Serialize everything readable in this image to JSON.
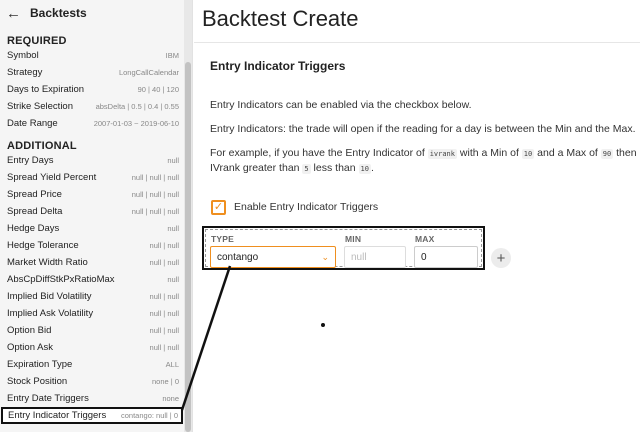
{
  "sidebar": {
    "back_icon": "arrow-left-icon",
    "title": "Backtests",
    "required_label": "REQUIRED",
    "required_items": [
      {
        "label": "Symbol",
        "value": "IBM"
      },
      {
        "label": "Strategy",
        "value": "LongCallCalendar"
      },
      {
        "label": "Days to Expiration",
        "value": "90 | 40 | 120"
      },
      {
        "label": "Strike Selection",
        "value": "absDelta | 0.5 | 0.4 | 0.55"
      },
      {
        "label": "Date Range",
        "value": "2007-01-03 ~ 2019-06-10"
      }
    ],
    "additional_label": "ADDITIONAL",
    "additional_items": [
      {
        "label": "Entry Days",
        "value": "null"
      },
      {
        "label": "Spread Yield Percent",
        "value": "null | null | null"
      },
      {
        "label": "Spread Price",
        "value": "null | null | null"
      },
      {
        "label": "Spread Delta",
        "value": "null | null | null"
      },
      {
        "label": "Hedge Days",
        "value": "null"
      },
      {
        "label": "Hedge Tolerance",
        "value": "null | null"
      },
      {
        "label": "Market Width Ratio",
        "value": "null | null"
      },
      {
        "label": "AbsCpDiffStkPxRatioMax",
        "value": "null"
      },
      {
        "label": "Implied Bid Volatility",
        "value": "null | null"
      },
      {
        "label": "Implied Ask Volatility",
        "value": "null | null"
      },
      {
        "label": "Option Bid",
        "value": "null | null"
      },
      {
        "label": "Option Ask",
        "value": "null | null"
      },
      {
        "label": "Expiration Type",
        "value": "ALL"
      },
      {
        "label": "Stock Position",
        "value": "none | 0"
      },
      {
        "label": "Entry Date Triggers",
        "value": "none"
      },
      {
        "label": "Entry Indicator Triggers",
        "value": "contango: null | 0"
      }
    ]
  },
  "main": {
    "title": "Backtest Create",
    "section_title": "Entry Indicator Triggers",
    "para1": "Entry Indicators can be enabled via the checkbox below.",
    "para2": "Entry Indicators: the trade will open if the reading for a day is between the Min and the Max.",
    "para3_a": "For example, if you have the Entry Indicator of ",
    "para3_code1": "ivrank",
    "para3_b": " with a Min of ",
    "para3_code2": "10",
    "para3_c": " and a Max of ",
    "para3_code3": "90",
    "para3_d": " then",
    "para4_a": "IVrank greater than ",
    "para4_code1": "5",
    "para4_b": " less than ",
    "para4_code2": "10",
    "para4_c": ".",
    "checkbox_label": "Enable Entry Indicator Triggers",
    "checkbox_checked": true,
    "type_label": "TYPE",
    "min_label": "MIN",
    "max_label": "MAX",
    "type_value": "contango",
    "min_placeholder": "null",
    "max_value": "0",
    "add_icon": "plus-icon"
  },
  "colors": {
    "accent": "#ef8f1f",
    "sidebar_bg": "#f5f5f5"
  }
}
